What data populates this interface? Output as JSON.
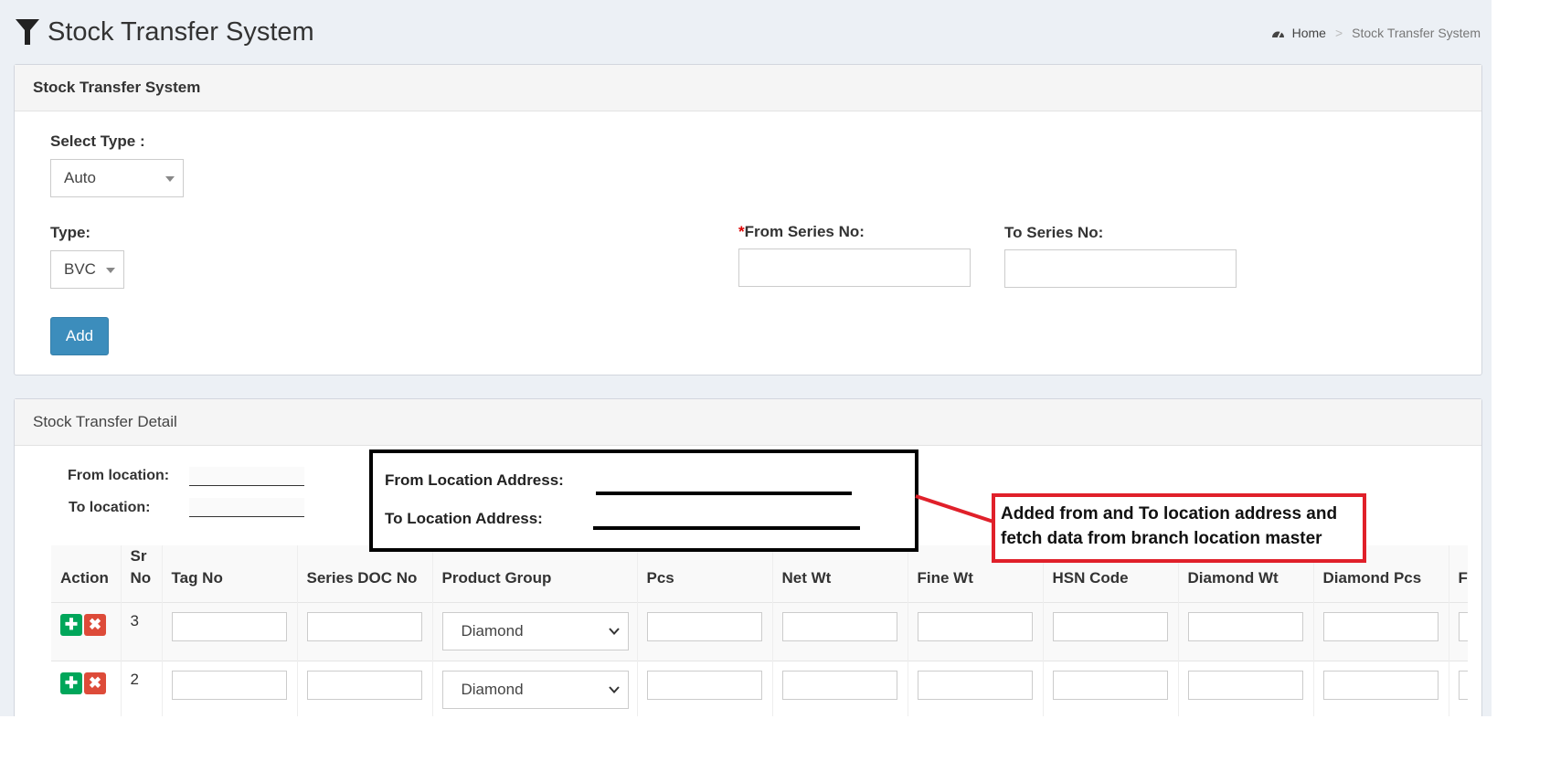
{
  "header": {
    "title": "Stock Transfer System",
    "breadcrumb": {
      "home": "Home",
      "separator": ">",
      "current": "Stock Transfer System"
    }
  },
  "form": {
    "panel_title": "Stock Transfer System",
    "select_type_label": "Select Type :",
    "select_type_value": "Auto",
    "type_label": "Type:",
    "type_value": "BVC",
    "from_series_required": "*",
    "from_series_label": "From Series No:",
    "to_series_label": "To Series No:",
    "add_button": "Add"
  },
  "detail": {
    "panel_title": "Stock Transfer Detail",
    "from_location_label": "From location:",
    "to_location_label": "To location:",
    "columns": [
      "Action",
      "Sr No",
      "Tag No",
      "Series DOC No",
      "Product Group",
      "Pcs",
      "Net Wt",
      "Fine Wt",
      "HSN Code",
      "Diamond Wt",
      "Diamond Pcs",
      "F"
    ],
    "rows": [
      {
        "sr_no": "3",
        "product_group": "Diamond"
      },
      {
        "sr_no": "2",
        "product_group": "Diamond"
      }
    ]
  },
  "annotation": {
    "from_address_label": "From Location Address:",
    "to_address_label": "To Location Address:",
    "note": "Added  from and To location address and fetch data from branch location master"
  },
  "colors": {
    "primary": "#3c8dbc",
    "success": "#00a65a",
    "danger": "#dd4b39",
    "annotation_red": "#e0202a",
    "background": "#ecf0f5"
  }
}
